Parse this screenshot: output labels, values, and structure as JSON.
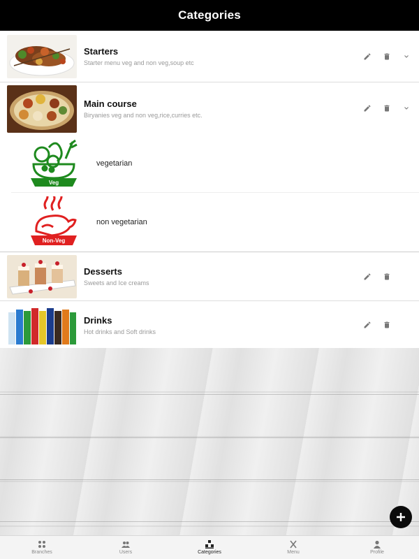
{
  "header": {
    "title": "Categories"
  },
  "categories": [
    {
      "title": "Starters",
      "description": "Starter menu veg and non veg,soup etc",
      "expandable": true
    },
    {
      "title": "Main course",
      "description": "Biryanies veg and non veg,rice,curries etc.",
      "expandable": true,
      "expanded": true,
      "subcategories": [
        {
          "label": "vegetarian",
          "badge": "Veg",
          "color": "#1e8a1e"
        },
        {
          "label": "non vegetarian",
          "badge": "Non-Veg",
          "color": "#e02020"
        }
      ]
    },
    {
      "title": "Desserts",
      "description": "Sweets and Ice creams",
      "expandable": false
    },
    {
      "title": "Drinks",
      "description": "Hot drinks and Soft drinks",
      "expandable": false
    }
  ],
  "fab": {
    "icon": "plus-icon"
  },
  "bottom_nav": [
    {
      "label": "Branches",
      "icon": "branches-icon"
    },
    {
      "label": "Users",
      "icon": "users-icon"
    },
    {
      "label": "Categories",
      "icon": "categories-icon",
      "active": true
    },
    {
      "label": "Menu",
      "icon": "menu-icon"
    },
    {
      "label": "Profile",
      "icon": "profile-icon"
    }
  ],
  "colors": {
    "header_bg": "#000000",
    "veg": "#1e8a1e",
    "nonveg": "#e02020",
    "icon_grey": "#777777"
  }
}
